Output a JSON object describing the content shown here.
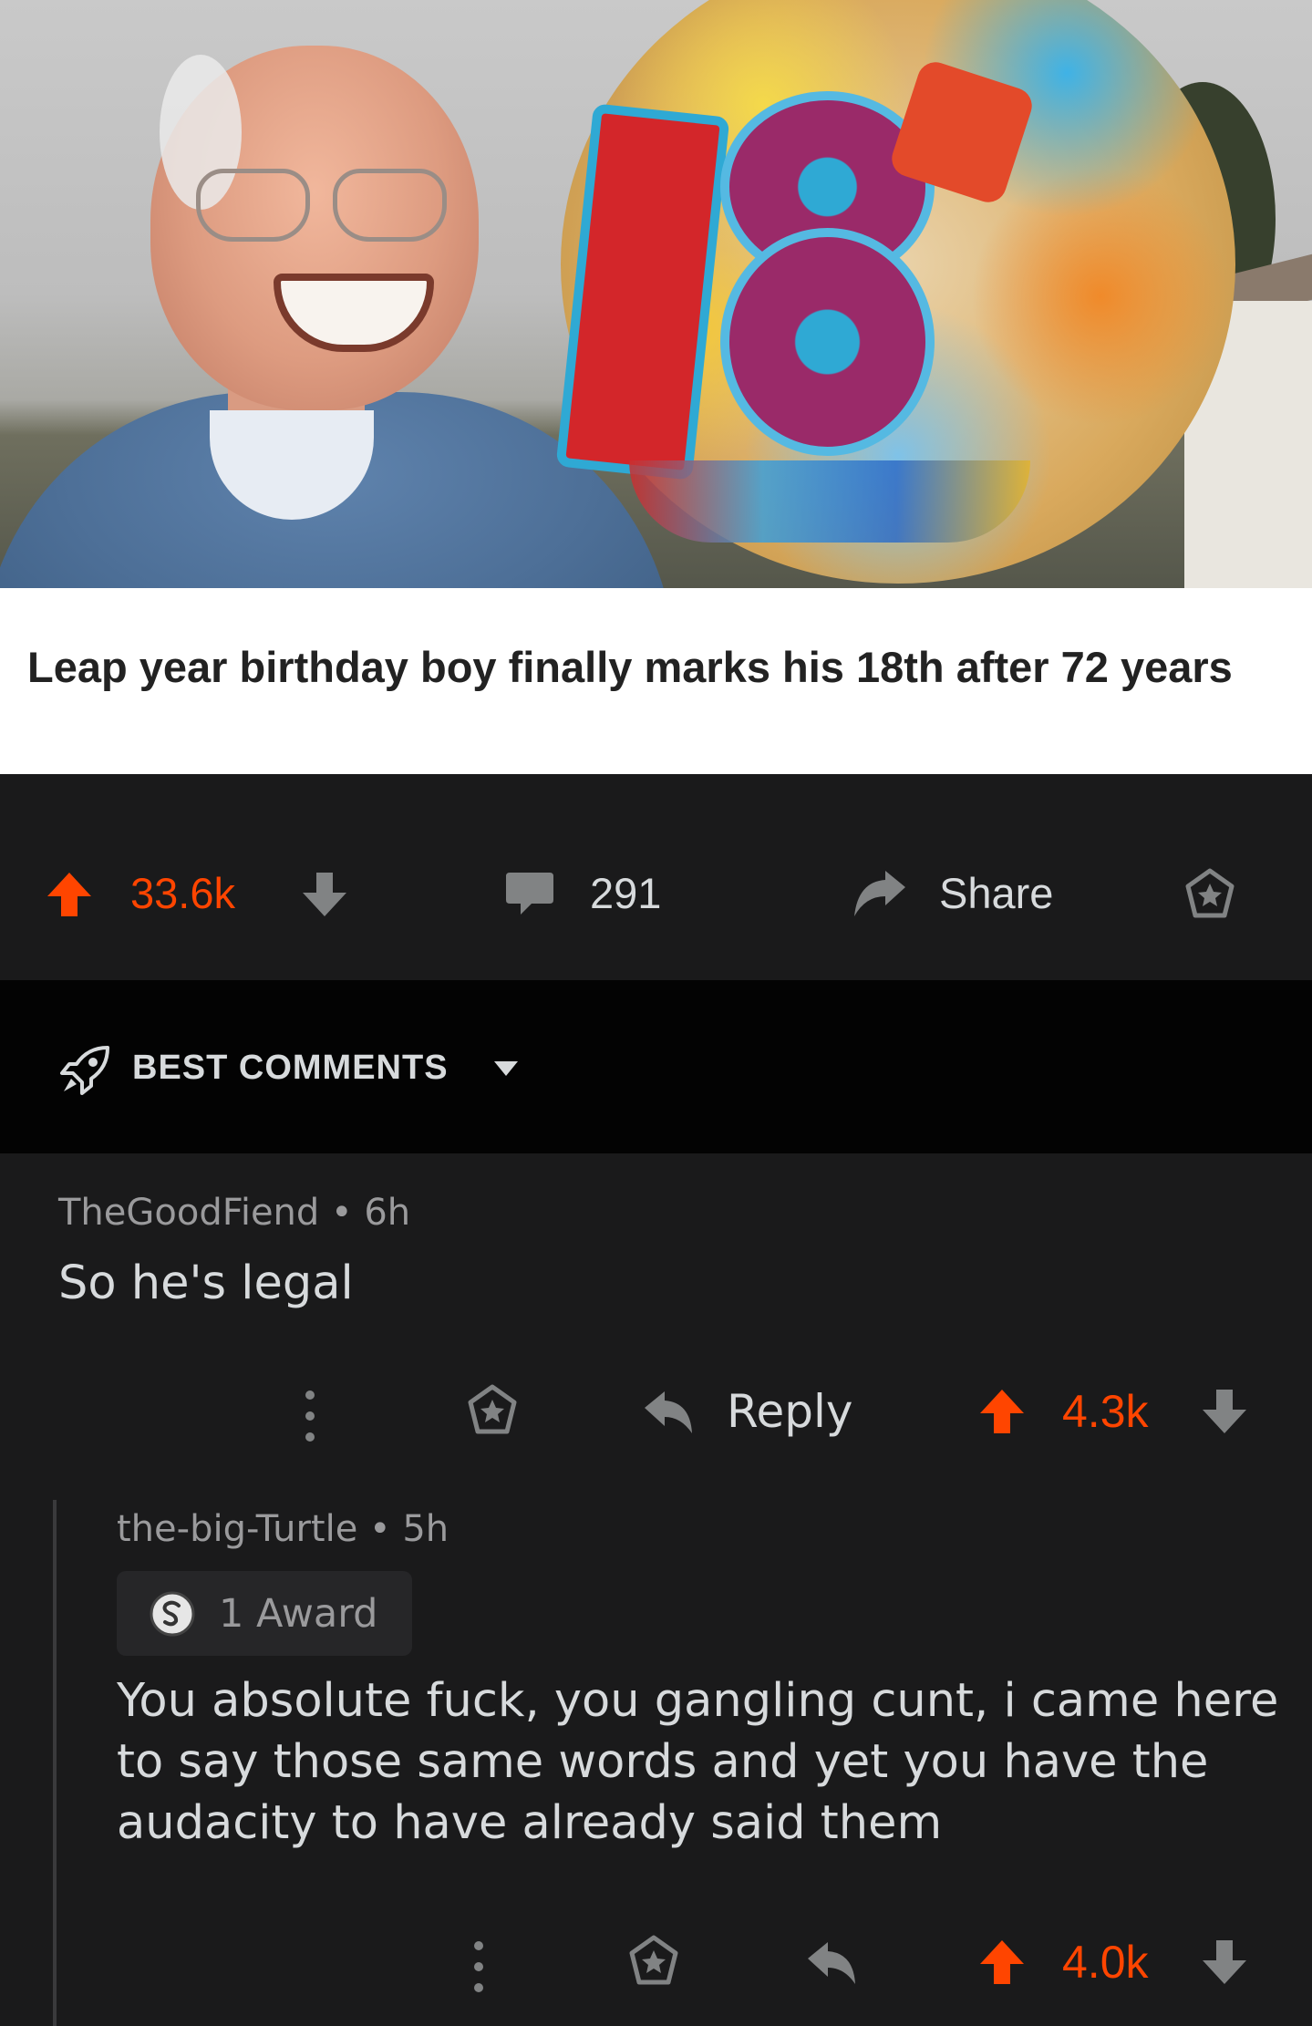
{
  "post": {
    "headline": "Leap year birthday boy finally marks his 18th after 72 years",
    "score": "33.6k",
    "comments": "291",
    "share_label": "Share"
  },
  "sort": {
    "label": "BEST COMMENTS"
  },
  "comments": [
    {
      "author": "TheGoodFiend",
      "age": "6h",
      "body": "So he's legal",
      "reply_label": "Reply",
      "score": "4.3k"
    },
    {
      "author": "the-big-Turtle",
      "age": "5h",
      "award": "1 Award",
      "body": "You absolute fuck, you gangling cunt, i came here to say those same words and yet you have the audacity to have already said them",
      "score": "4.0k"
    }
  ],
  "colors": {
    "upvote": "#ff4500",
    "text": "#d7dadc",
    "muted": "#9a9a9c",
    "background": "#1a1a1b",
    "sort_bar": "#030303"
  },
  "icons": {
    "upvote": "arrow-up-icon",
    "downvote": "arrow-down-icon",
    "comments": "speech-bubble-icon",
    "share": "share-arrow-icon",
    "award": "award-star-icon",
    "sort": "rocket-icon",
    "more": "vertical-dots-icon",
    "reply": "reply-arrow-icon",
    "silver": "silver-award-icon"
  }
}
